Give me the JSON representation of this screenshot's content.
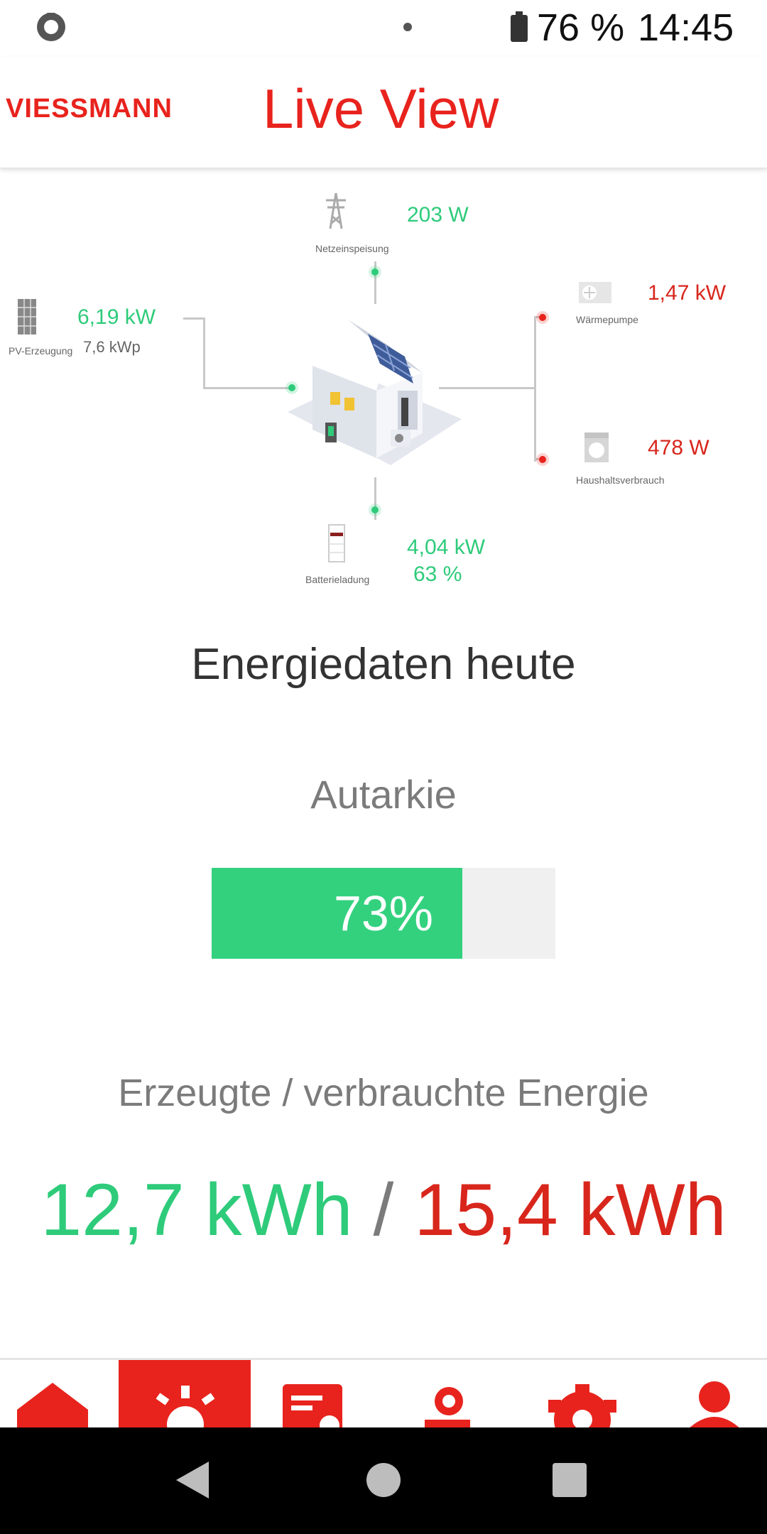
{
  "status_bar": {
    "battery": "76 %",
    "time": "14:45",
    "icons": [
      "sync-icon",
      "dot-icon",
      "battery-icon"
    ]
  },
  "header": {
    "brand": "VIESSMANN",
    "title": "Live View"
  },
  "energy_flow": {
    "grid": {
      "label": "Netzeinspeisung",
      "value": "203 W",
      "icon": "power-pylon-icon"
    },
    "pv": {
      "label": "PV-Erzeugung",
      "value": "6,19 kW",
      "peak": "7,6 kWp",
      "icon": "solar-panel-icon"
    },
    "heat_pump": {
      "label": "Wärmepumpe",
      "value": "1,47 kW",
      "icon": "heat-pump-icon"
    },
    "household": {
      "label": "Haushaltsverbrauch",
      "value": "478 W",
      "icon": "washing-machine-icon"
    },
    "battery": {
      "label": "Batterieladung",
      "value": "4,04 kW",
      "percent": "63 %",
      "icon": "battery-storage-icon"
    }
  },
  "today": {
    "heading": "Energiedaten heute",
    "autarky_label": "Autarkie",
    "autarky_text": "73%",
    "autarky_fraction": 0.73,
    "energy_label": "Erzeugte / verbrauchte Energie",
    "produced": "12,7 kWh",
    "separator": "/",
    "consumed": "15,4 kWh"
  },
  "bottom_nav": {
    "active_index": 1,
    "items": [
      "home-icon",
      "sun-icon",
      "report-icon",
      "heat-pump-icon",
      "settings-icon",
      "user-icon"
    ]
  },
  "colors": {
    "brand_red": "#e8231d",
    "green": "#2ecb7a",
    "red_value": "#d8261c"
  }
}
